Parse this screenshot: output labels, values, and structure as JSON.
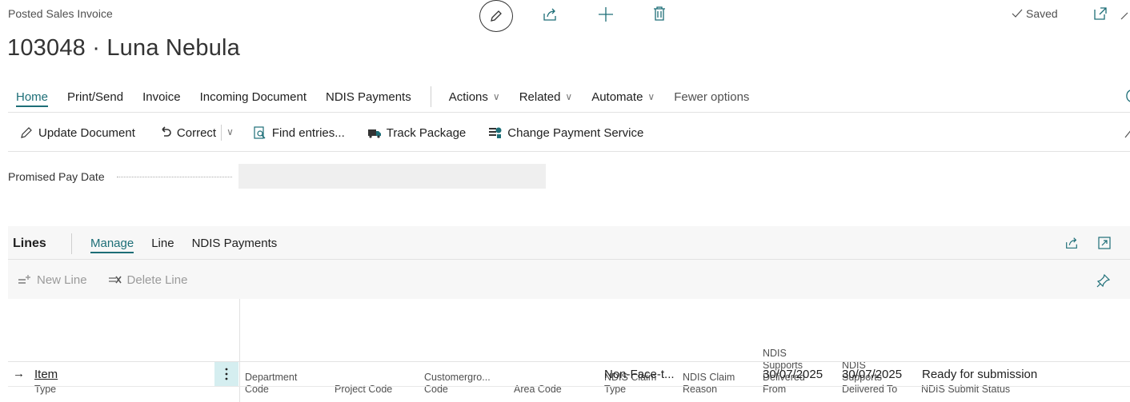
{
  "header": {
    "doc_type": "Posted Sales Invoice",
    "title": "103048 · Luna Nebula",
    "saved_label": "Saved"
  },
  "action_bar": {
    "tabs": [
      "Home",
      "Print/Send",
      "Invoice",
      "Incoming Document",
      "NDIS Payments"
    ],
    "menus": [
      "Actions",
      "Related",
      "Automate"
    ],
    "fewer_options": "Fewer options"
  },
  "promoted_actions": {
    "update_document": "Update Document",
    "correct": "Correct",
    "find_entries": "Find entries...",
    "track_package": "Track Package",
    "change_payment_service": "Change Payment Service"
  },
  "fields": {
    "promised_pay_date_label": "Promised Pay Date",
    "promised_pay_date_value": ""
  },
  "lines": {
    "title": "Lines",
    "tabs": [
      "Manage",
      "Line",
      "NDIS Payments"
    ],
    "toolbar": {
      "new_line": "New Line",
      "delete_line": "Delete Line"
    },
    "columns": {
      "type": "Type",
      "department_code": "Department Code",
      "project_code": "Project Code",
      "customergroup_code": "Customergro... Code",
      "area_code": "Area Code",
      "ndis_claim_type": "NDIS Claim Type",
      "ndis_claim_reason": "NDIS Claim Reason",
      "ndis_delivered_from": "NDIS Supports Delivered From",
      "ndis_delivered_to": "NDIS Supports Delivered To",
      "ndis_submit_status": "NDIS Submit Status"
    },
    "rows": [
      {
        "type": "Item",
        "ndis_claim_type": "Non-Face-t...",
        "ndis_delivered_from": "30/07/2025",
        "ndis_delivered_to": "30/07/2025",
        "ndis_submit_status": "Ready for submission"
      }
    ]
  },
  "colors": {
    "accent": "#1d6e77",
    "row_menu_bg": "#d5eef0",
    "disabled_text": "#9a9a9a"
  }
}
